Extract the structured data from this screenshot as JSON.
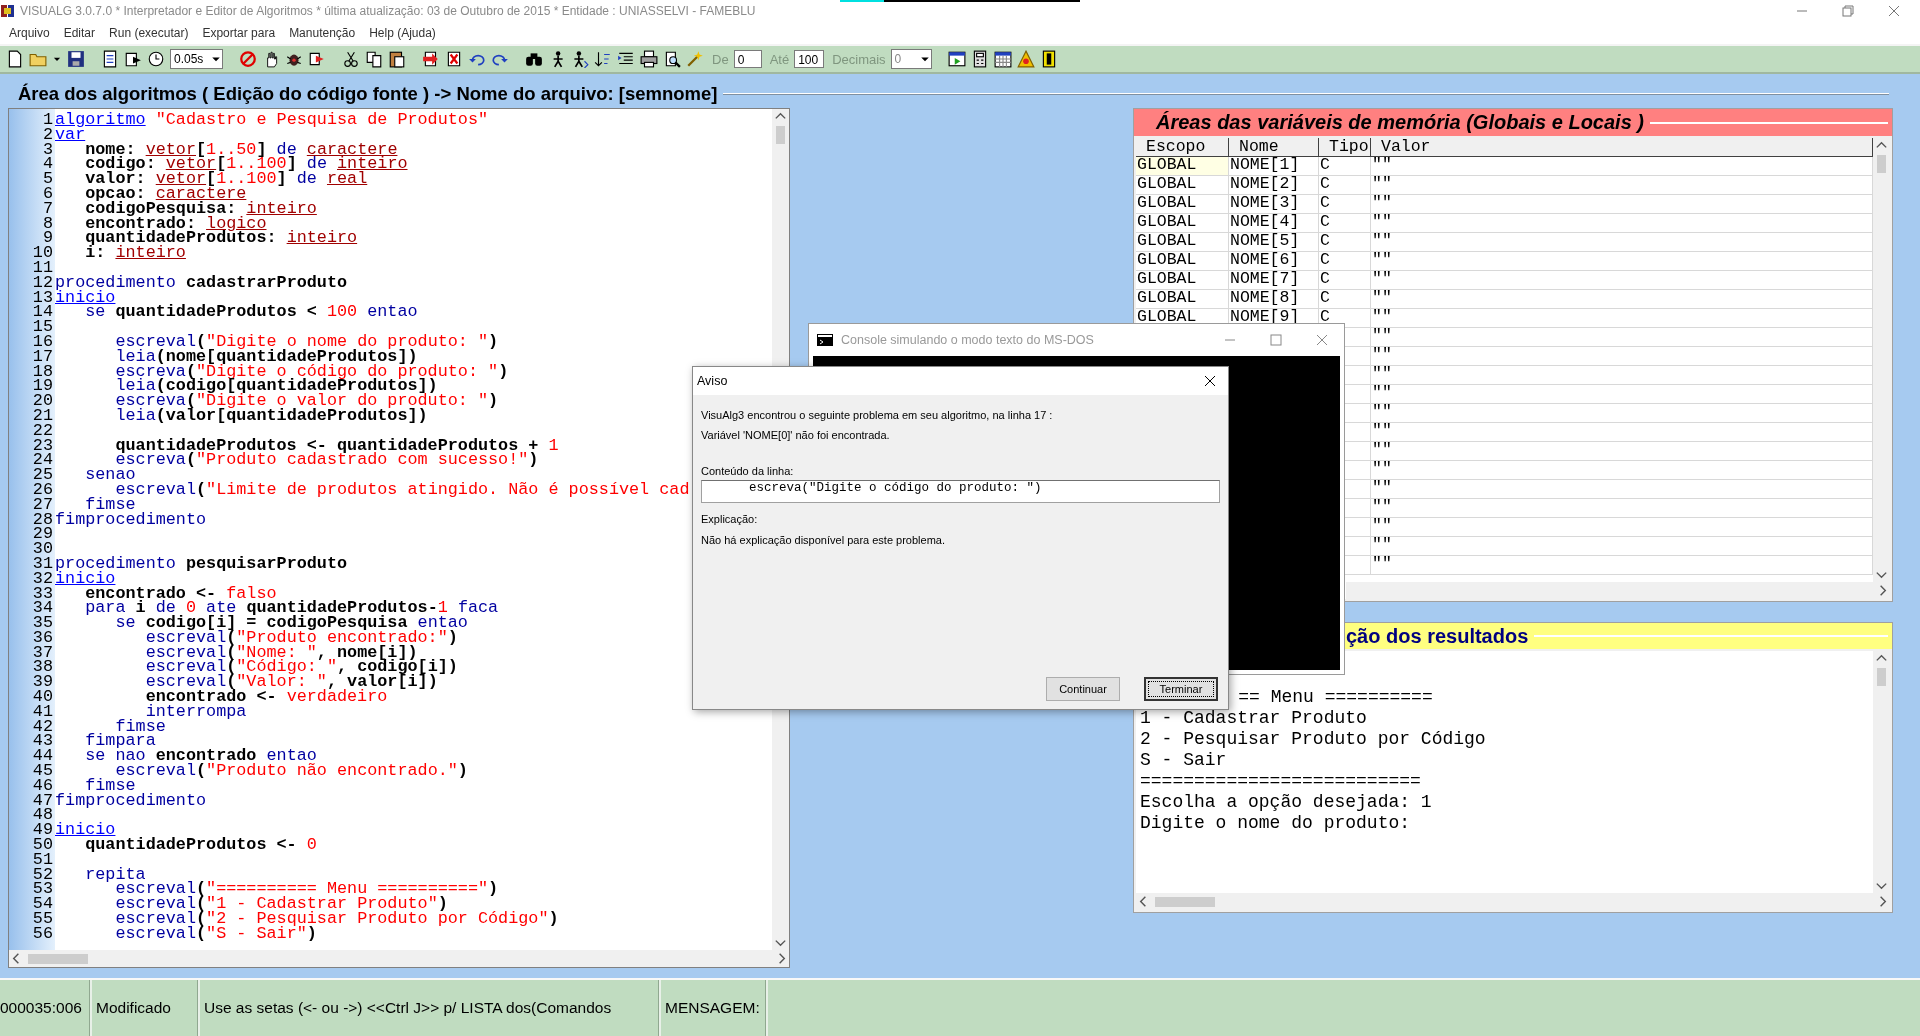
{
  "window": {
    "title": "VISUALG 3.0.7.0 * Interpretador e Editor de Algoritmos * última atualização: 03 de Outubro de 2015 * Entidade : UNIASSELVI - FAMEBLU"
  },
  "menu": [
    "Arquivo",
    "Editar",
    "Run (executar)",
    "Exportar para",
    "Manutenção",
    "Help (Ajuda)"
  ],
  "toolbar": {
    "speed": "0.05s",
    "range": {
      "from_label": "De",
      "from_value": "0",
      "to_label": "Até",
      "to_value": "100",
      "decimals_label": "Decimais",
      "decimals_value": "0",
      "disabled": true
    }
  },
  "editor": {
    "title": "Área dos algoritmos ( Edição do código fonte ) -> Nome do arquivo: [semnome]",
    "lines": [
      {
        "number": "1",
        "tokens": [
          {
            "text": "algoritmo",
            "kind": "kwu"
          },
          {
            "text": " \"Cadastro e Pesquisa de Produtos\"",
            "kind": "str"
          }
        ]
      },
      {
        "number": "2",
        "tokens": [
          {
            "text": "var",
            "kind": "kwu"
          }
        ]
      },
      {
        "number": "3",
        "tokens": [
          {
            "text": "   nome: ",
            "kind": "id"
          },
          {
            "text": "vetor",
            "kind": "type"
          },
          {
            "text": "[",
            "kind": "id"
          },
          {
            "text": "1..50",
            "kind": "num"
          },
          {
            "text": "] ",
            "kind": "id"
          },
          {
            "text": "de ",
            "kind": "kw"
          },
          {
            "text": "caractere",
            "kind": "type"
          }
        ]
      },
      {
        "number": "4",
        "tokens": [
          {
            "text": "   codigo: ",
            "kind": "id"
          },
          {
            "text": "vetor",
            "kind": "type"
          },
          {
            "text": "[",
            "kind": "id"
          },
          {
            "text": "1..100",
            "kind": "num"
          },
          {
            "text": "] ",
            "kind": "id"
          },
          {
            "text": "de ",
            "kind": "kw"
          },
          {
            "text": "inteiro",
            "kind": "type"
          }
        ]
      },
      {
        "number": "5",
        "tokens": [
          {
            "text": "   valor: ",
            "kind": "id"
          },
          {
            "text": "vetor",
            "kind": "type"
          },
          {
            "text": "[",
            "kind": "id"
          },
          {
            "text": "1..100",
            "kind": "num"
          },
          {
            "text": "] ",
            "kind": "id"
          },
          {
            "text": "de ",
            "kind": "kw"
          },
          {
            "text": "real",
            "kind": "type"
          }
        ]
      },
      {
        "number": "6",
        "tokens": [
          {
            "text": "   opcao: ",
            "kind": "id"
          },
          {
            "text": "caractere",
            "kind": "type"
          }
        ]
      },
      {
        "number": "7",
        "tokens": [
          {
            "text": "   codigoPesquisa: ",
            "kind": "id"
          },
          {
            "text": "inteiro",
            "kind": "type"
          }
        ]
      },
      {
        "number": "8",
        "tokens": [
          {
            "text": "   encontrado: ",
            "kind": "id"
          },
          {
            "text": "logico",
            "kind": "type"
          }
        ]
      },
      {
        "number": "9",
        "tokens": [
          {
            "text": "   quantidadeProdutos: ",
            "kind": "id"
          },
          {
            "text": "inteiro",
            "kind": "type"
          }
        ]
      },
      {
        "number": "10",
        "tokens": [
          {
            "text": "   i: ",
            "kind": "id"
          },
          {
            "text": "inteiro",
            "kind": "type"
          }
        ]
      },
      {
        "number": "11"
      },
      {
        "number": "12",
        "tokens": [
          {
            "text": "procedimento",
            "kind": "kw"
          },
          {
            "text": " cadastrarProduto",
            "kind": "id"
          }
        ]
      },
      {
        "number": "13",
        "tokens": [
          {
            "text": "inicio",
            "kind": "kwu"
          }
        ]
      },
      {
        "number": "14",
        "tokens": [
          {
            "text": "   se",
            "kind": "kw"
          },
          {
            "text": " quantidadeProdutos < ",
            "kind": "id"
          },
          {
            "text": "100",
            "kind": "num"
          },
          {
            "text": " entao",
            "kind": "kw"
          }
        ]
      },
      {
        "number": "15"
      },
      {
        "number": "16",
        "tokens": [
          {
            "text": "      escreval",
            "kind": "kw"
          },
          {
            "text": "(",
            "kind": "id"
          },
          {
            "text": "\"Digite o nome do produto: \"",
            "kind": "str"
          },
          {
            "text": ")",
            "kind": "id"
          }
        ]
      },
      {
        "number": "17",
        "tokens": [
          {
            "text": "      leia",
            "kind": "kw"
          },
          {
            "text": "(nome[quantidadeProdutos])",
            "kind": "id"
          }
        ]
      },
      {
        "number": "18",
        "tokens": [
          {
            "text": "      escreva",
            "kind": "kw"
          },
          {
            "text": "(",
            "kind": "id"
          },
          {
            "text": "\"Digite o código do produto: \"",
            "kind": "str"
          },
          {
            "text": ")",
            "kind": "id"
          }
        ]
      },
      {
        "number": "19",
        "tokens": [
          {
            "text": "      leia",
            "kind": "kw"
          },
          {
            "text": "(codigo[quantidadeProdutos])",
            "kind": "id"
          }
        ]
      },
      {
        "number": "20",
        "tokens": [
          {
            "text": "      escreva",
            "kind": "kw"
          },
          {
            "text": "(",
            "kind": "id"
          },
          {
            "text": "\"Digite o valor do produto: \"",
            "kind": "str"
          },
          {
            "text": ")",
            "kind": "id"
          }
        ]
      },
      {
        "number": "21",
        "tokens": [
          {
            "text": "      leia",
            "kind": "kw"
          },
          {
            "text": "(valor[quantidadeProdutos])",
            "kind": "id"
          }
        ]
      },
      {
        "number": "22"
      },
      {
        "number": "23",
        "tokens": [
          {
            "text": "      quantidadeProdutos <- quantidadeProdutos + ",
            "kind": "id"
          },
          {
            "text": "1",
            "kind": "num"
          }
        ]
      },
      {
        "number": "24",
        "tokens": [
          {
            "text": "      escreva",
            "kind": "kw"
          },
          {
            "text": "(",
            "kind": "id"
          },
          {
            "text": "\"Produto cadastrado com sucesso!\"",
            "kind": "str"
          },
          {
            "text": ")",
            "kind": "id"
          }
        ]
      },
      {
        "number": "25",
        "tokens": [
          {
            "text": "   senao",
            "kind": "kw"
          }
        ]
      },
      {
        "number": "26",
        "tokens": [
          {
            "text": "      escreval",
            "kind": "kw"
          },
          {
            "text": "(",
            "kind": "id"
          },
          {
            "text": "\"Limite de produtos atingido. Não é possível cad",
            "kind": "str"
          }
        ]
      },
      {
        "number": "27",
        "tokens": [
          {
            "text": "   fimse",
            "kind": "kw"
          }
        ]
      },
      {
        "number": "28",
        "tokens": [
          {
            "text": "fimprocedimento",
            "kind": "kw"
          }
        ]
      },
      {
        "number": "29"
      },
      {
        "number": "30"
      },
      {
        "number": "31",
        "tokens": [
          {
            "text": "procedimento",
            "kind": "kw"
          },
          {
            "text": " pesquisarProduto",
            "kind": "id"
          }
        ]
      },
      {
        "number": "32",
        "tokens": [
          {
            "text": "inicio",
            "kind": "kwu"
          }
        ]
      },
      {
        "number": "33",
        "tokens": [
          {
            "text": "   encontrado <- ",
            "kind": "id"
          },
          {
            "text": "falso",
            "kind": "num"
          }
        ]
      },
      {
        "number": "34",
        "tokens": [
          {
            "text": "   para",
            "kind": "kw"
          },
          {
            "text": " i ",
            "kind": "id"
          },
          {
            "text": "de",
            "kind": "kw"
          },
          {
            "text": " 0 ",
            "kind": "num"
          },
          {
            "text": "ate",
            "kind": "kw"
          },
          {
            "text": " quantidadeProdutos-",
            "kind": "id"
          },
          {
            "text": "1",
            "kind": "num"
          },
          {
            "text": " faca",
            "kind": "kw"
          }
        ]
      },
      {
        "number": "35",
        "tokens": [
          {
            "text": "      se",
            "kind": "kw"
          },
          {
            "text": " codigo[i] = codigoPesquisa ",
            "kind": "id"
          },
          {
            "text": "entao",
            "kind": "kw"
          }
        ]
      },
      {
        "number": "36",
        "tokens": [
          {
            "text": "         escreval",
            "kind": "kw"
          },
          {
            "text": "(",
            "kind": "id"
          },
          {
            "text": "\"Produto encontrado:\"",
            "kind": "str"
          },
          {
            "text": ")",
            "kind": "id"
          }
        ]
      },
      {
        "number": "37",
        "tokens": [
          {
            "text": "         escreval",
            "kind": "kw"
          },
          {
            "text": "(",
            "kind": "id"
          },
          {
            "text": "\"Nome: \"",
            "kind": "str"
          },
          {
            "text": ", nome[i])",
            "kind": "id"
          }
        ]
      },
      {
        "number": "38",
        "tokens": [
          {
            "text": "         escreval",
            "kind": "kw"
          },
          {
            "text": "(",
            "kind": "id"
          },
          {
            "text": "\"Código: \"",
            "kind": "str"
          },
          {
            "text": ", codigo[i])",
            "kind": "id"
          }
        ]
      },
      {
        "number": "39",
        "tokens": [
          {
            "text": "         escreval",
            "kind": "kw"
          },
          {
            "text": "(",
            "kind": "id"
          },
          {
            "text": "\"Valor: \"",
            "kind": "str"
          },
          {
            "text": ", valor[i])",
            "kind": "id"
          }
        ]
      },
      {
        "number": "40",
        "tokens": [
          {
            "text": "         encontrado <- ",
            "kind": "id"
          },
          {
            "text": "verdadeiro",
            "kind": "num"
          }
        ]
      },
      {
        "number": "41",
        "tokens": [
          {
            "text": "         interrompa",
            "kind": "kw"
          }
        ]
      },
      {
        "number": "42",
        "tokens": [
          {
            "text": "      fimse",
            "kind": "kw"
          }
        ]
      },
      {
        "number": "43",
        "tokens": [
          {
            "text": "   fimpara",
            "kind": "kw"
          }
        ]
      },
      {
        "number": "44",
        "tokens": [
          {
            "text": "   se nao",
            "kind": "kw"
          },
          {
            "text": " encontrado ",
            "kind": "id"
          },
          {
            "text": "entao",
            "kind": "kw"
          }
        ]
      },
      {
        "number": "45",
        "tokens": [
          {
            "text": "      escreval",
            "kind": "kw"
          },
          {
            "text": "(",
            "kind": "id"
          },
          {
            "text": "\"Produto não encontrado.\"",
            "kind": "str"
          },
          {
            "text": ")",
            "kind": "id"
          }
        ]
      },
      {
        "number": "46",
        "tokens": [
          {
            "text": "   fimse",
            "kind": "kw"
          }
        ]
      },
      {
        "number": "47",
        "tokens": [
          {
            "text": "fimprocedimento",
            "kind": "kw"
          }
        ]
      },
      {
        "number": "48"
      },
      {
        "number": "49",
        "tokens": [
          {
            "text": "inicio",
            "kind": "kwu"
          }
        ]
      },
      {
        "number": "50",
        "tokens": [
          {
            "text": "   quantidadeProdutos <- ",
            "kind": "id"
          },
          {
            "text": "0",
            "kind": "num"
          }
        ]
      },
      {
        "number": "51"
      },
      {
        "number": "52",
        "tokens": [
          {
            "text": "   repita",
            "kind": "kw"
          }
        ]
      },
      {
        "number": "53",
        "tokens": [
          {
            "text": "      escreval",
            "kind": "kw"
          },
          {
            "text": "(",
            "kind": "id"
          },
          {
            "text": "\"========== Menu ==========\"",
            "kind": "str"
          },
          {
            "text": ")",
            "kind": "id"
          }
        ]
      },
      {
        "number": "54",
        "tokens": [
          {
            "text": "      escreval",
            "kind": "kw"
          },
          {
            "text": "(",
            "kind": "id"
          },
          {
            "text": "\"1 - Cadastrar Produto\"",
            "kind": "str"
          },
          {
            "text": ")",
            "kind": "id"
          }
        ]
      },
      {
        "number": "55",
        "tokens": [
          {
            "text": "      escreval",
            "kind": "kw"
          },
          {
            "text": "(",
            "kind": "id"
          },
          {
            "text": "\"2 - Pesquisar Produto por Código\"",
            "kind": "str"
          },
          {
            "text": ")",
            "kind": "id"
          }
        ]
      },
      {
        "number": "56",
        "tokens": [
          {
            "text": "      escreval",
            "kind": "kw"
          },
          {
            "text": "(",
            "kind": "id"
          },
          {
            "text": "\"S - Sair\"",
            "kind": "str"
          },
          {
            "text": ")",
            "kind": "id"
          }
        ]
      }
    ]
  },
  "variables": {
    "title": "Áreas das variáveis de memória (Globais e Locais )",
    "columns": [
      "Escopo",
      "Nome",
      "Tipo",
      "Valor"
    ],
    "rows": [
      {
        "scope": "GLOBAL",
        "name": "NOME[1]",
        "type": "C",
        "value": "\"\"",
        "selected": true
      },
      {
        "scope": "GLOBAL",
        "name": "NOME[2]",
        "type": "C",
        "value": "\"\"",
        "selected": false
      },
      {
        "scope": "GLOBAL",
        "name": "NOME[3]",
        "type": "C",
        "value": "\"\"",
        "selected": false
      },
      {
        "scope": "GLOBAL",
        "name": "NOME[4]",
        "type": "C",
        "value": "\"\"",
        "selected": false
      },
      {
        "scope": "GLOBAL",
        "name": "NOME[5]",
        "type": "C",
        "value": "\"\"",
        "selected": false
      },
      {
        "scope": "GLOBAL",
        "name": "NOME[6]",
        "type": "C",
        "value": "\"\"",
        "selected": false
      },
      {
        "scope": "GLOBAL",
        "name": "NOME[7]",
        "type": "C",
        "value": "\"\"",
        "selected": false
      },
      {
        "scope": "GLOBAL",
        "name": "NOME[8]",
        "type": "C",
        "value": "\"\"",
        "selected": false
      },
      {
        "scope": "GLOBAL",
        "name": "NOME[9]",
        "type": "C",
        "value": "\"\"",
        "selected": false
      },
      {
        "value": "\"\""
      },
      {
        "value": "\"\""
      },
      {
        "value": "\"\""
      },
      {
        "value": "\"\""
      },
      {
        "value": "\"\""
      },
      {
        "value": "\"\""
      },
      {
        "value": "\"\""
      },
      {
        "value": "\"\""
      },
      {
        "value": "\"\""
      },
      {
        "value": "\"\""
      },
      {
        "value": "\"\""
      },
      {
        "value": "\"\""
      },
      {
        "value": "\"\""
      }
    ]
  },
  "results": {
    "title": "ção dos resultados",
    "lines": [
      {
        "text": "== Menu ==========",
        "kind": "partial"
      },
      {
        "text": "1 - Cadastrar Produto",
        "kind": "full"
      },
      {
        "text": "2 - Pesquisar Produto por Código",
        "kind": "full"
      },
      {
        "text": "S - Sair",
        "kind": "full"
      },
      {
        "text": "==========================",
        "kind": "full"
      },
      {
        "text": "Escolha a opção desejada: 1",
        "kind": "full"
      },
      {
        "text": "Digite o nome do produto:",
        "kind": "full"
      }
    ]
  },
  "console": {
    "title": "Console simulando o modo texto do MS-DOS",
    "active": false
  },
  "dialog": {
    "title": "Aviso",
    "message": "VisuAlg3 encontrou o seguinte problema em seu algoritmo, na linha 17 :",
    "detail": "Variável 'NOME[0]' não foi encontrada.",
    "line_label": "Conteúdo da linha:",
    "line_value": "      escreva(\"Digite o código do produto: \")",
    "explanation_label": "Explicação:",
    "explanation": "Não há explicação disponível para este problema.",
    "buttons": [
      {
        "label": "Continuar",
        "default": false
      },
      {
        "label": "Terminar",
        "default": true
      }
    ]
  },
  "status_bar": [
    "000035:006",
    "Modificado",
    "Use as setas (<- ou ->) <<Ctrl J>> p/ LISTA dos(Comandos",
    "MENSAGEM:"
  ]
}
